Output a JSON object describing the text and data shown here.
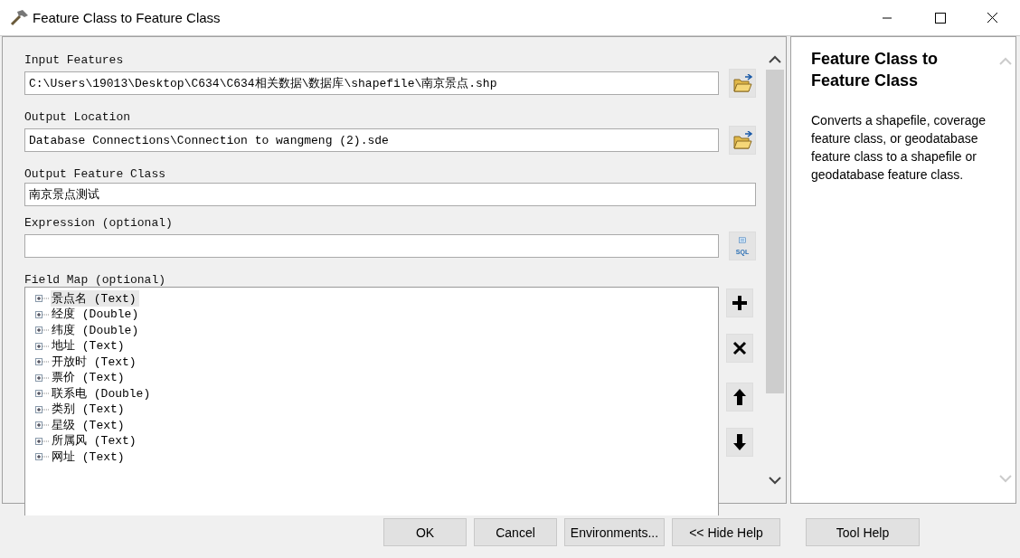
{
  "window": {
    "title": "Feature Class to Feature Class"
  },
  "parameters": [
    {
      "kind": "path",
      "label": "Input Features",
      "value": "C:\\Users\\19013\\Desktop\\C634\\C634相关数据\\数据库\\shapefile\\南京景点.shp"
    },
    {
      "kind": "path",
      "label": "Output Location",
      "value": "Database Connections\\Connection to wangmeng (2).sde"
    },
    {
      "kind": "text",
      "label": "Output Feature Class",
      "value": "南京景点测试"
    },
    {
      "kind": "sql",
      "label": "Expression (optional)",
      "sql_label": "SQL"
    }
  ],
  "field_map": {
    "label": "Field Map (optional)",
    "items": [
      {
        "label": "景点名 (Text)",
        "selected": true
      },
      {
        "label": "经度 (Double)",
        "selected": false
      },
      {
        "label": "纬度 (Double)",
        "selected": false
      },
      {
        "label": "地址 (Text)",
        "selected": false
      },
      {
        "label": "开放时 (Text)",
        "selected": false
      },
      {
        "label": "票价 (Text)",
        "selected": false
      },
      {
        "label": "联系电 (Double)",
        "selected": false
      },
      {
        "label": "类别 (Text)",
        "selected": false
      },
      {
        "label": "星级 (Text)",
        "selected": false
      },
      {
        "label": "所属风 (Text)",
        "selected": false
      },
      {
        "label": "网址 (Text)",
        "selected": false
      }
    ],
    "tools": [
      {
        "kind": "add"
      },
      {
        "kind": "remove"
      },
      {
        "kind": "up"
      },
      {
        "kind": "down"
      }
    ]
  },
  "help": {
    "title": "Feature Class to Feature Class",
    "text": "Converts a shapefile, coverage feature class, or geodatabase feature class to a shapefile or geodatabase feature class."
  },
  "buttons": [
    "OK",
    "Cancel",
    "Environments...",
    "<< Hide Help",
    "Tool Help"
  ]
}
